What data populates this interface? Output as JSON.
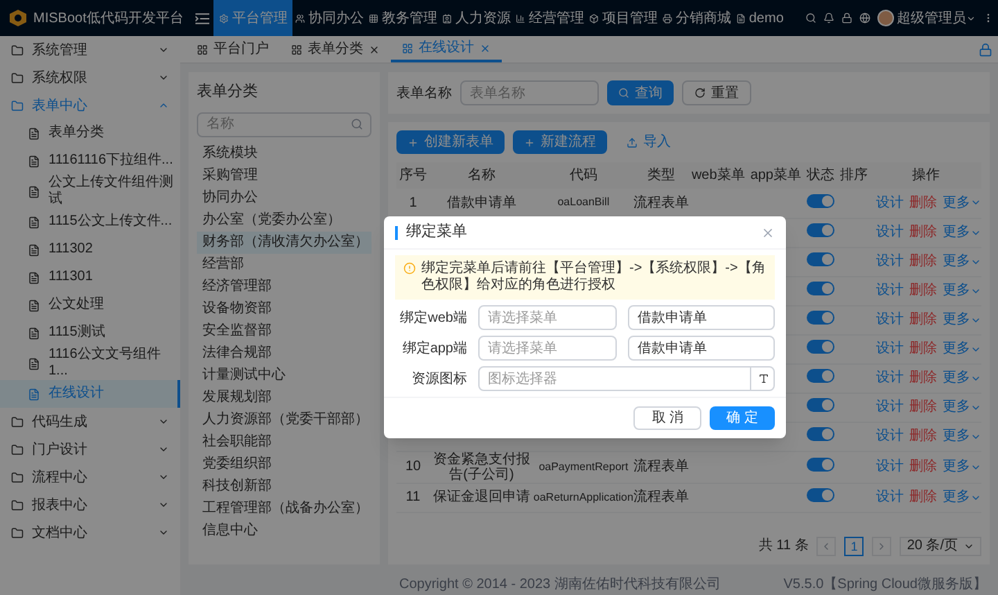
{
  "app": {
    "logo_text": "MISBoot低代码开发平台"
  },
  "top_nav": [
    {
      "label": "平台管理",
      "selected": true
    },
    {
      "label": "协同办公",
      "selected": false
    },
    {
      "label": "教务管理",
      "selected": false
    },
    {
      "label": "人力资源",
      "selected": false
    },
    {
      "label": "经营管理",
      "selected": false
    },
    {
      "label": "项目管理",
      "selected": false
    },
    {
      "label": "分销商城",
      "selected": false
    },
    {
      "label": "demo",
      "selected": false
    }
  ],
  "user": {
    "name": "超级管理员"
  },
  "sidebar": {
    "items": [
      {
        "label": "系统管理",
        "expanded": false,
        "selected": false
      },
      {
        "label": "系统权限",
        "expanded": false,
        "selected": false
      },
      {
        "label": "表单中心",
        "expanded": true,
        "selected": false,
        "children": [
          {
            "label": "表单分类",
            "selected": false
          },
          {
            "label": "11161116下拉组件...",
            "selected": false
          },
          {
            "label": "公文上传文件组件测试",
            "selected": false
          },
          {
            "label": "1115公文上传文件...",
            "selected": false
          },
          {
            "label": "111302",
            "selected": false
          },
          {
            "label": "111301",
            "selected": false
          },
          {
            "label": "公文处理",
            "selected": false
          },
          {
            "label": "1115测试",
            "selected": false
          },
          {
            "label": "1116公文文号组件1...",
            "selected": false
          },
          {
            "label": "在线设计",
            "selected": true
          }
        ]
      },
      {
        "label": "代码生成",
        "expanded": false,
        "selected": false
      },
      {
        "label": "门户设计",
        "expanded": false,
        "selected": false
      },
      {
        "label": "流程中心",
        "expanded": false,
        "selected": false
      },
      {
        "label": "报表中心",
        "expanded": false,
        "selected": false
      },
      {
        "label": "文档中心",
        "expanded": false,
        "selected": false
      }
    ]
  },
  "tabs": [
    {
      "label": "平台门户",
      "closable": false,
      "selected": false
    },
    {
      "label": "表单分类",
      "closable": true,
      "selected": false
    },
    {
      "label": "在线设计",
      "closable": true,
      "selected": true
    }
  ],
  "categories": {
    "title": "表单分类",
    "search_placeholder": "名称",
    "items": [
      {
        "label": "系统模块",
        "selected": false
      },
      {
        "label": "采购管理",
        "selected": false
      },
      {
        "label": "协同办公",
        "selected": false
      },
      {
        "label": "办公室（党委办公室）",
        "selected": false
      },
      {
        "label": "财务部（清收清欠办公室）",
        "selected": true
      },
      {
        "label": "经营部",
        "selected": false
      },
      {
        "label": "经济管理部",
        "selected": false
      },
      {
        "label": "设备物资部",
        "selected": false
      },
      {
        "label": "安全监督部",
        "selected": false
      },
      {
        "label": "法律合规部",
        "selected": false
      },
      {
        "label": "计量测试中心",
        "selected": false
      },
      {
        "label": "发展规划部",
        "selected": false
      },
      {
        "label": "人力资源部（党委干部部）",
        "selected": false
      },
      {
        "label": "社会职能部",
        "selected": false
      },
      {
        "label": "党委组织部",
        "selected": false
      },
      {
        "label": "科技创新部",
        "selected": false
      },
      {
        "label": "工程管理部（战备办公室）",
        "selected": false
      },
      {
        "label": "信息中心",
        "selected": false
      }
    ]
  },
  "search": {
    "label": "表单名称",
    "placeholder": "表单名称",
    "search_button": "查询",
    "reset_button": "重置"
  },
  "toolbar": {
    "create_form": "创建新表单",
    "create_flow": "新建流程",
    "import": "导入"
  },
  "table": {
    "columns": [
      "序号",
      "名称",
      "代码",
      "类型",
      "web菜单",
      "app菜单",
      "状态",
      "排序",
      "操作"
    ],
    "rows": [
      {
        "index": "1",
        "name": "借款申请单",
        "code": "oaLoanBill",
        "type": "流程表单",
        "on": true,
        "actions": [
          "设计",
          "删除",
          "更多"
        ]
      },
      {
        "on": true,
        "actions": [
          "设计",
          "删除",
          "更多"
        ]
      },
      {
        "on": true,
        "actions": [
          "设计",
          "删除",
          "更多"
        ]
      },
      {
        "on": true,
        "actions": [
          "设计",
          "删除",
          "更多"
        ]
      },
      {
        "on": true,
        "actions": [
          "设计",
          "删除",
          "更多"
        ]
      },
      {
        "on": true,
        "actions": [
          "设计",
          "删除",
          "更多"
        ]
      },
      {
        "on": true,
        "actions": [
          "设计",
          "删除",
          "更多"
        ]
      },
      {
        "on": true,
        "actions": [
          "设计",
          "删除",
          "更多"
        ]
      },
      {
        "on": true,
        "actions": [
          "设计",
          "删除",
          "更多"
        ]
      },
      {
        "index": "10",
        "name": "资金紧急支付报告(子公司)",
        "code": "oaPaymentReport",
        "type": "流程表单",
        "on": true,
        "actions": [
          "设计",
          "删除",
          "更多"
        ]
      },
      {
        "index": "11",
        "name": "保证金退回申请",
        "code": "oaReturnApplication",
        "type": "流程表单",
        "on": true,
        "actions": [
          "设计",
          "删除",
          "更多"
        ]
      }
    ]
  },
  "pagination": {
    "total": "共 11 条",
    "pages": [
      {
        "label": "1",
        "selected": true
      }
    ],
    "page_size": "20 条/页"
  },
  "footer": {
    "copyright": "Copyright © 2014 - 2023 湖南佐佑时代科技有限公司",
    "version": "V5.5.0【Spring Cloud微服务版】"
  },
  "modal": {
    "title": "绑定菜单",
    "notice": "绑定完菜单后请前往【平台管理】->【系统权限】->【角色权限】给对应的角色进行授权",
    "fields": [
      {
        "kind": "menu",
        "label": "绑定web端",
        "placeholder": "请选择菜单",
        "value": "借款申请单"
      },
      {
        "kind": "menu",
        "label": "绑定app端",
        "placeholder": "请选择菜单",
        "value": "借款申请单"
      },
      {
        "kind": "icon",
        "label": "资源图标",
        "placeholder": "图标选择器"
      }
    ],
    "cancel": "取 消",
    "ok": "确 定"
  }
}
